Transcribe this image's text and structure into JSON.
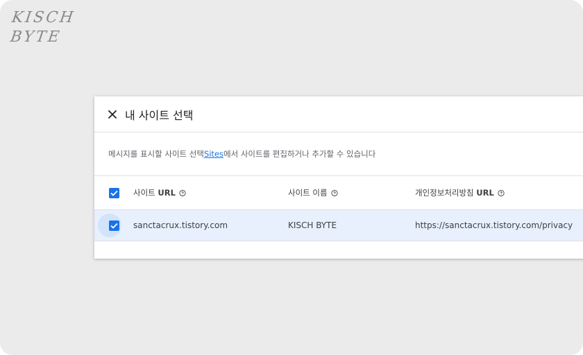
{
  "watermark": {
    "line1": "KISCH",
    "line2": "BYTE"
  },
  "dialog": {
    "title": "내 사이트 선택",
    "description_prefix": "메시지를 표시할 사이트 선택 ",
    "description_link": "Sites",
    "description_suffix": "에서 사이트를 편집하거나 추가할 수 있습니다"
  },
  "table": {
    "columns": [
      {
        "label": "사이트",
        "bold_suffix": "URL"
      },
      {
        "label": "사이트 이름",
        "bold_suffix": ""
      },
      {
        "label": "개인정보처리방침",
        "bold_suffix": "URL"
      }
    ],
    "rows": [
      {
        "checked": true,
        "url": "sanctacrux.tistory.com",
        "name": "KISCH BYTE",
        "privacy_url": "https://sanctacrux.tistory.com/privacy"
      }
    ]
  },
  "colors": {
    "accent": "#1a73e8",
    "selected_row": "#e8f0fe",
    "frame": "#ebebeb"
  },
  "icons": {
    "close": "close-icon",
    "help": "help-circle-icon",
    "check": "check-icon"
  }
}
